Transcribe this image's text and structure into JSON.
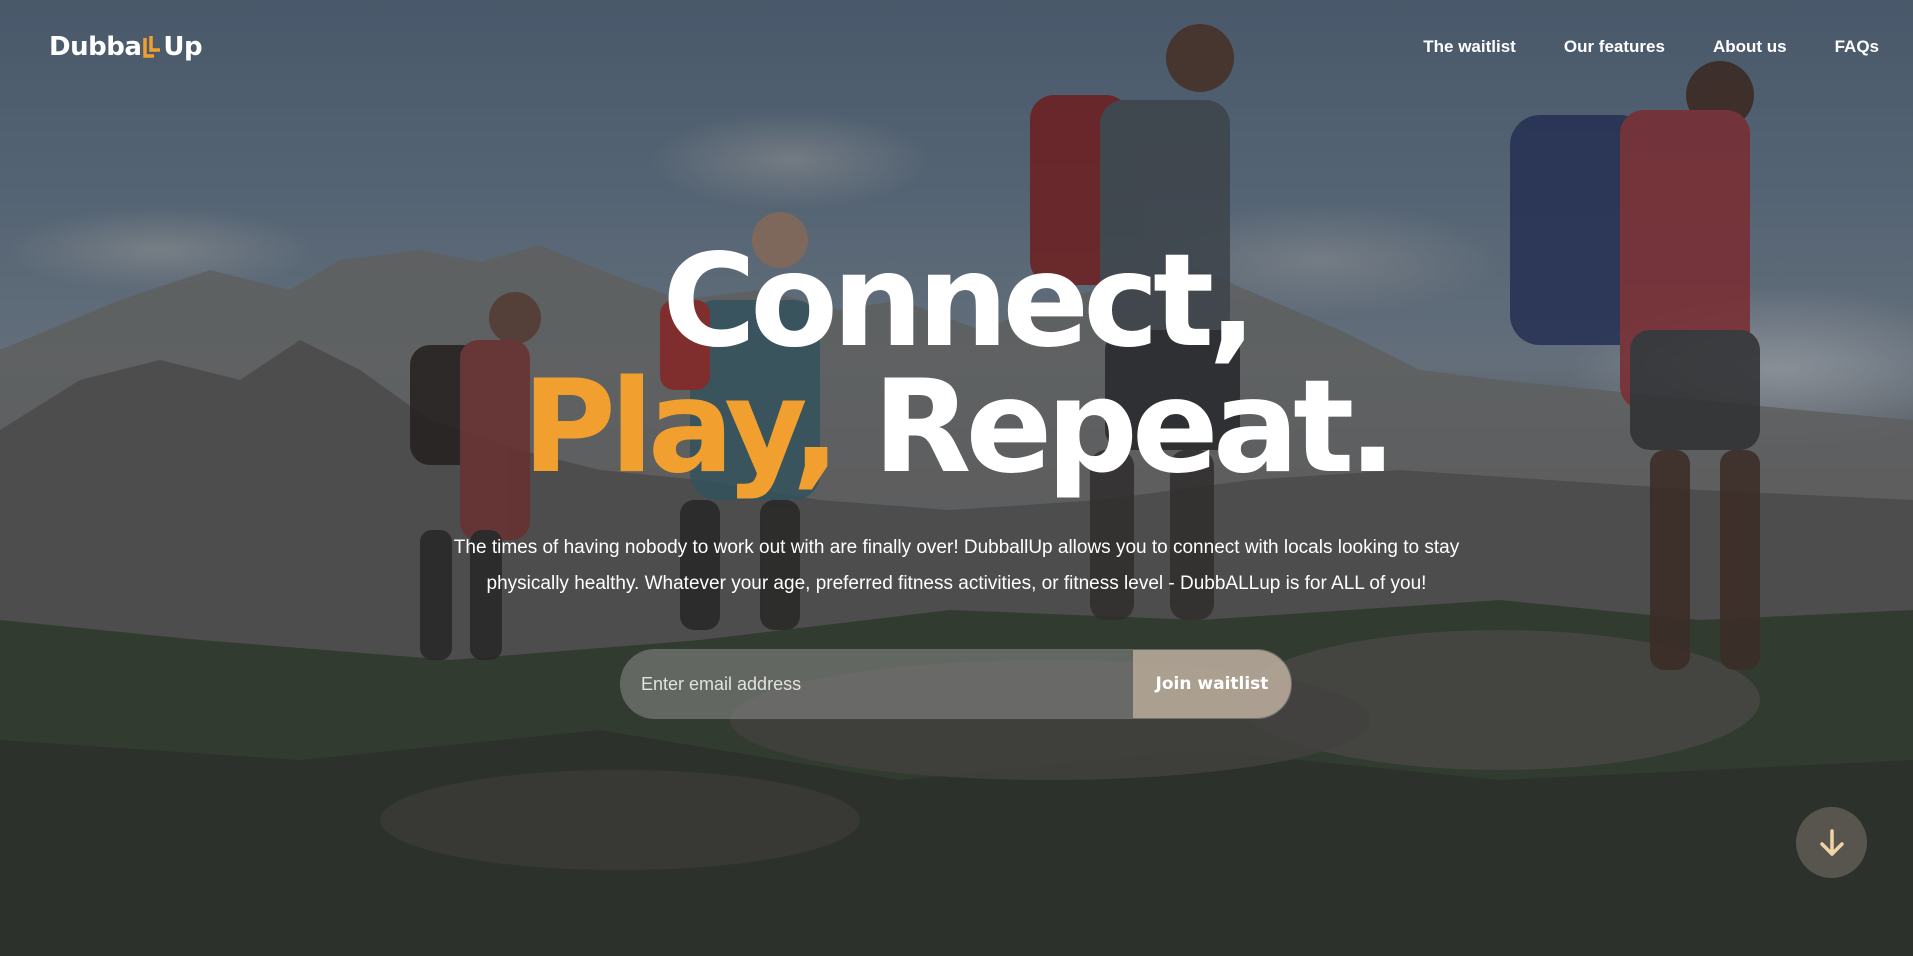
{
  "brand": {
    "logo_text_left": "Dubba",
    "logo_text_right": "Up",
    "accent_color": "#f1a030"
  },
  "nav": {
    "items": [
      {
        "label": "The waitlist"
      },
      {
        "label": "Our features"
      },
      {
        "label": "About us"
      },
      {
        "label": "FAQs"
      }
    ]
  },
  "hero": {
    "headline_line1": "Connect,",
    "headline_accent": "Play,",
    "headline_rest": "Repeat.",
    "subtitle_line1": "The times of having nobody to work out with are finally over! DubballUp allows you to connect with locals looking to stay",
    "subtitle_line2": "physically healthy. Whatever your age, preferred fitness activities, or fitness level - DubbALLup is for ALL of you!"
  },
  "waitlist_form": {
    "email_placeholder": "Enter email address",
    "email_value": "",
    "submit_label": "Join waitlist"
  },
  "scroll_button": {
    "icon": "arrow-down-icon"
  }
}
